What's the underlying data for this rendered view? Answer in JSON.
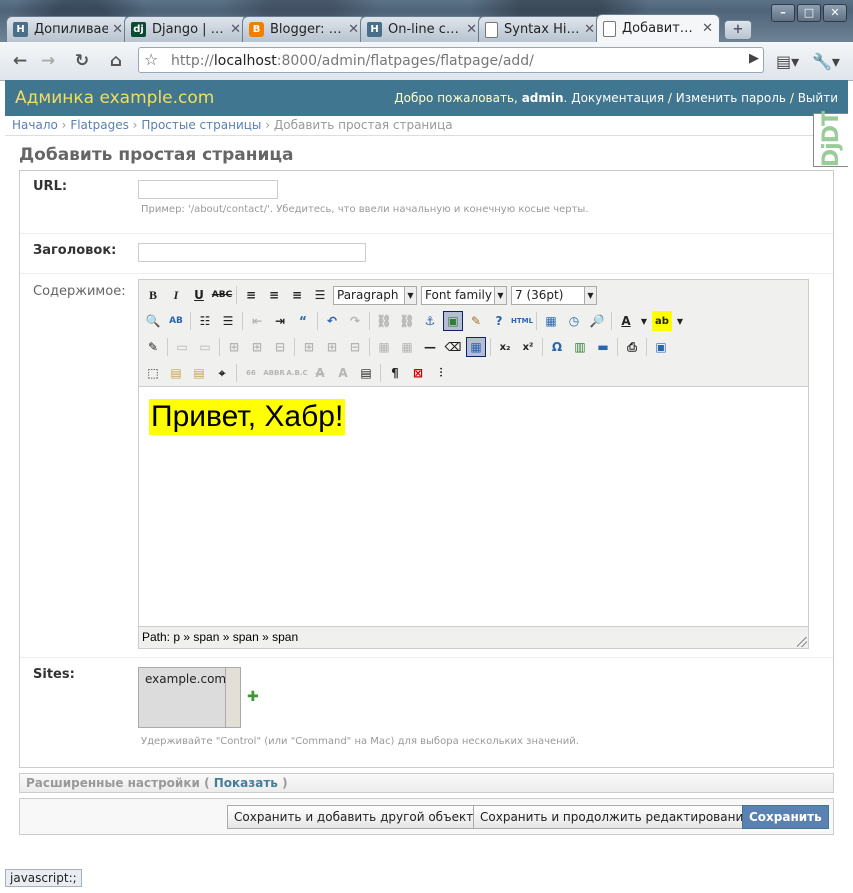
{
  "browser": {
    "tabs": [
      {
        "title": "Допиливаем",
        "favicon": "H",
        "active": false
      },
      {
        "title": "Django | …",
        "favicon": "dj",
        "active": false
      },
      {
        "title": "Blogger: …",
        "favicon": "B",
        "active": false
      },
      {
        "title": "On-line c…",
        "favicon": "H",
        "active": false
      },
      {
        "title": "Syntax Hi…",
        "favicon": "doc",
        "active": false
      },
      {
        "title": "Добавит…",
        "favicon": "doc",
        "active": true
      }
    ],
    "url_prefix": "http://",
    "url_host": "localhost",
    "url_rest": ":8000/admin/flatpages/flatpage/add/"
  },
  "header": {
    "branding": "Админка example.com",
    "welcome": "Добро пожаловать,",
    "username": "admin",
    "docs": "Документация",
    "change_password": "Изменить пароль",
    "logout": "Выйти",
    "separator": "/"
  },
  "breadcrumbs": {
    "home": "Начало",
    "app": "Flatpages",
    "model": "Простые страницы",
    "current": "Добавить простая страница",
    "sep": "›"
  },
  "debug_toolbar": {
    "label": "DjDT"
  },
  "page_title": "Добавить простая страница",
  "form": {
    "url": {
      "label": "URL:",
      "value": "",
      "help": "Пример: '/about/contact/'. Убедитесь, что ввели начальную и конечную косые черты."
    },
    "title": {
      "label": "Заголовок:",
      "value": ""
    },
    "content": {
      "label": "Содержимое:"
    },
    "sites": {
      "label": "Sites:",
      "options": [
        "example.com"
      ],
      "help": "Удерживайте \"Control\" (или \"Command\" на Mac) для выбора нескольких значений."
    }
  },
  "editor": {
    "format_select": "Paragraph",
    "font_family_select": "Font family",
    "font_size_select": "7 (36pt)",
    "content_text": "Привет, Хабр!",
    "highlight_color": "#ffff00",
    "path_label": "Path: p » span » span » span"
  },
  "advanced": {
    "label": "Расширенные настройки (",
    "show": "Показать",
    "close": ")"
  },
  "buttons": {
    "save_add": "Сохранить и добавить другой объект",
    "save_continue": "Сохранить и продолжить редактирование",
    "save": "Сохранить"
  },
  "status_text": "javascript:;",
  "colors": {
    "header_bg": "#417690",
    "branding": "#f5dd5d",
    "link": "#5b80b2",
    "primary_button": "#5b80b2"
  }
}
